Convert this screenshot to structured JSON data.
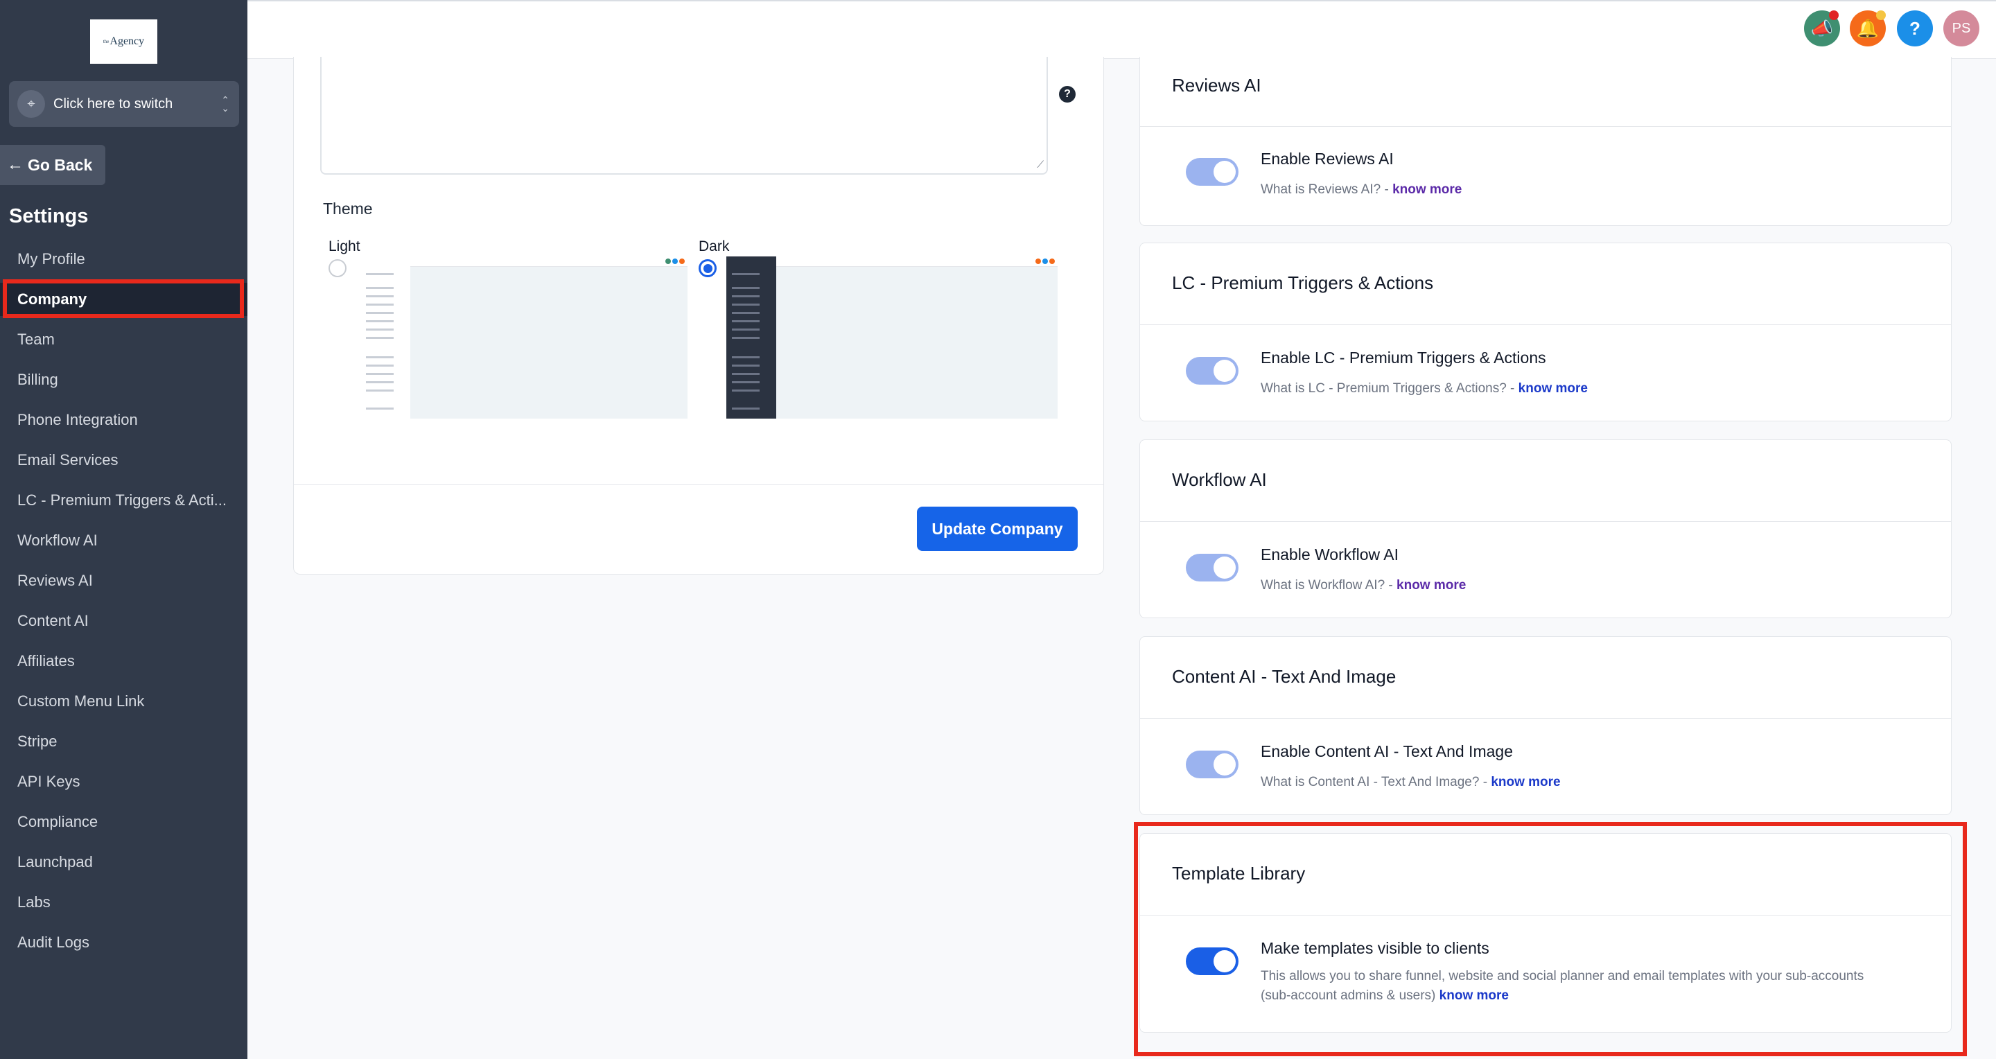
{
  "brand": {
    "logo_text": "Agency",
    "logo_sup": "the"
  },
  "switcher": {
    "label": "Click here to switch"
  },
  "go_back": {
    "label": "Go Back"
  },
  "settings": {
    "heading": "Settings"
  },
  "nav": {
    "items": [
      {
        "label": "My Profile"
      },
      {
        "label": "Company",
        "active": true
      },
      {
        "label": "Team"
      },
      {
        "label": "Billing"
      },
      {
        "label": "Phone Integration"
      },
      {
        "label": "Email Services"
      },
      {
        "label": "LC - Premium Triggers & Acti..."
      },
      {
        "label": "Workflow AI"
      },
      {
        "label": "Reviews AI"
      },
      {
        "label": "Content AI"
      },
      {
        "label": "Affiliates"
      },
      {
        "label": "Custom Menu Link"
      },
      {
        "label": "Stripe"
      },
      {
        "label": "API Keys"
      },
      {
        "label": "Compliance"
      },
      {
        "label": "Launchpad"
      },
      {
        "label": "Labs"
      },
      {
        "label": "Audit Logs"
      }
    ]
  },
  "topbar": {
    "announce_icon": "megaphone-icon",
    "bell_icon": "bell-icon",
    "help_icon": "question-icon",
    "help_glyph": "?",
    "avatar_initials": "PS"
  },
  "company_card": {
    "theme_label": "Theme",
    "theme_light": "Light",
    "theme_dark": "Dark",
    "selected_theme": "Dark",
    "update_button": "Update Company"
  },
  "features": [
    {
      "title": "Reviews AI",
      "enable_label": "Enable Reviews AI",
      "desc": "What is Reviews AI? - ",
      "link": "know more",
      "enabled": true
    },
    {
      "title": "LC - Premium Triggers & Actions",
      "enable_label": "Enable LC - Premium Triggers & Actions",
      "desc": "What is LC - Premium Triggers & Actions? - ",
      "link": "know more",
      "enabled": true
    },
    {
      "title": "Workflow AI",
      "enable_label": "Enable Workflow AI",
      "desc": "What is Workflow AI? - ",
      "link": "know more",
      "enabled": true
    },
    {
      "title": "Content AI - Text And Image",
      "enable_label": "Enable Content AI - Text And Image",
      "desc": "What is Content AI - Text And Image? - ",
      "link": "know more",
      "enabled": true
    },
    {
      "title": "Template Library",
      "enable_label": "Make templates visible to clients",
      "desc": "This allows you to share funnel, website and social planner and email templates with your sub-accounts (sub-account admins & users) ",
      "link": "know more",
      "enabled": true
    }
  ],
  "colors": {
    "sidebar_bg": "#313a4a",
    "accent_blue": "#1664e8",
    "highlight_red": "#e8291c"
  }
}
